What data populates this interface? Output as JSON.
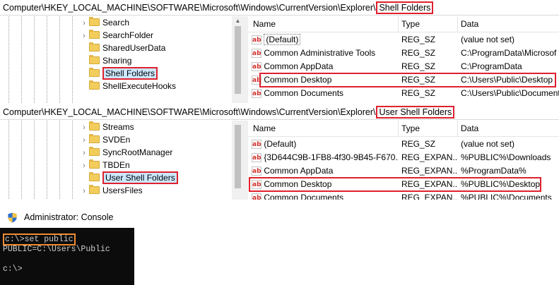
{
  "panel1": {
    "address_prefix": "Computer\\HKEY_LOCAL_MACHINE\\SOFTWARE\\Microsoft\\Windows\\CurrentVersion\\Explorer\\",
    "address_highlight": "Shell Folders",
    "tree": [
      {
        "label": "Search",
        "expandable": true
      },
      {
        "label": "SearchFolder",
        "expandable": true
      },
      {
        "label": "SharedUserData",
        "expandable": false
      },
      {
        "label": "Sharing",
        "expandable": false
      },
      {
        "label": "Shell Folders",
        "expandable": false,
        "selected": true
      },
      {
        "label": "ShellExecuteHooks",
        "expandable": false
      }
    ],
    "columns": {
      "name": "Name",
      "type": "Type",
      "data": "Data"
    },
    "rows": [
      {
        "name": "(Default)",
        "type": "REG_SZ",
        "data": "(value not set)"
      },
      {
        "name": "Common Administrative Tools",
        "type": "REG_SZ",
        "data": "C:\\ProgramData\\Microsof"
      },
      {
        "name": "Common AppData",
        "type": "REG_SZ",
        "data": "C:\\ProgramData"
      },
      {
        "name": "Common Desktop",
        "type": "REG_SZ",
        "data": "C:\\Users\\Public\\Desktop"
      },
      {
        "name": "Common Documents",
        "type": "REG_SZ",
        "data": "C:\\Users\\Public\\Documents"
      }
    ]
  },
  "panel2": {
    "address_prefix": "Computer\\HKEY_LOCAL_MACHINE\\SOFTWARE\\Microsoft\\Windows\\CurrentVersion\\Explorer\\",
    "address_highlight": "User Shell Folders",
    "tree": [
      {
        "label": "Streams",
        "expandable": true
      },
      {
        "label": "SVDEn",
        "expandable": true
      },
      {
        "label": "SyncRootManager",
        "expandable": true
      },
      {
        "label": "TBDEn",
        "expandable": true
      },
      {
        "label": "User Shell Folders",
        "expandable": false,
        "selected": true
      },
      {
        "label": "UsersFiles",
        "expandable": true
      }
    ],
    "columns": {
      "name": "Name",
      "type": "Type",
      "data": "Data"
    },
    "rows": [
      {
        "name": "(Default)",
        "type": "REG_SZ",
        "data": "(value not set)"
      },
      {
        "name": "{3D644C9B-1FB8-4f30-9B45-F670...",
        "type": "REG_EXPAN...",
        "data": "%PUBLIC%\\Downloads"
      },
      {
        "name": "Common AppData",
        "type": "REG_EXPAN...",
        "data": "%ProgramData%"
      },
      {
        "name": "Common Desktop",
        "type": "REG_EXPAN...",
        "data": "%PUBLIC%\\Desktop"
      },
      {
        "name": "Common Documents",
        "type": "REG_EXPAN...",
        "data": "%PUBLIC%\\Documents"
      }
    ]
  },
  "console": {
    "title": "Administrator: Console",
    "prompt": "c:\\>",
    "command": "set public",
    "output": "PUBLIC=C:\\Users\\Public",
    "prompt2": "c:\\>"
  },
  "colors": {
    "highlight": "#e0202e",
    "console_highlight": "#f08c35",
    "console_bg": "#0c0c0c",
    "selection_bg": "#cce8ff"
  }
}
